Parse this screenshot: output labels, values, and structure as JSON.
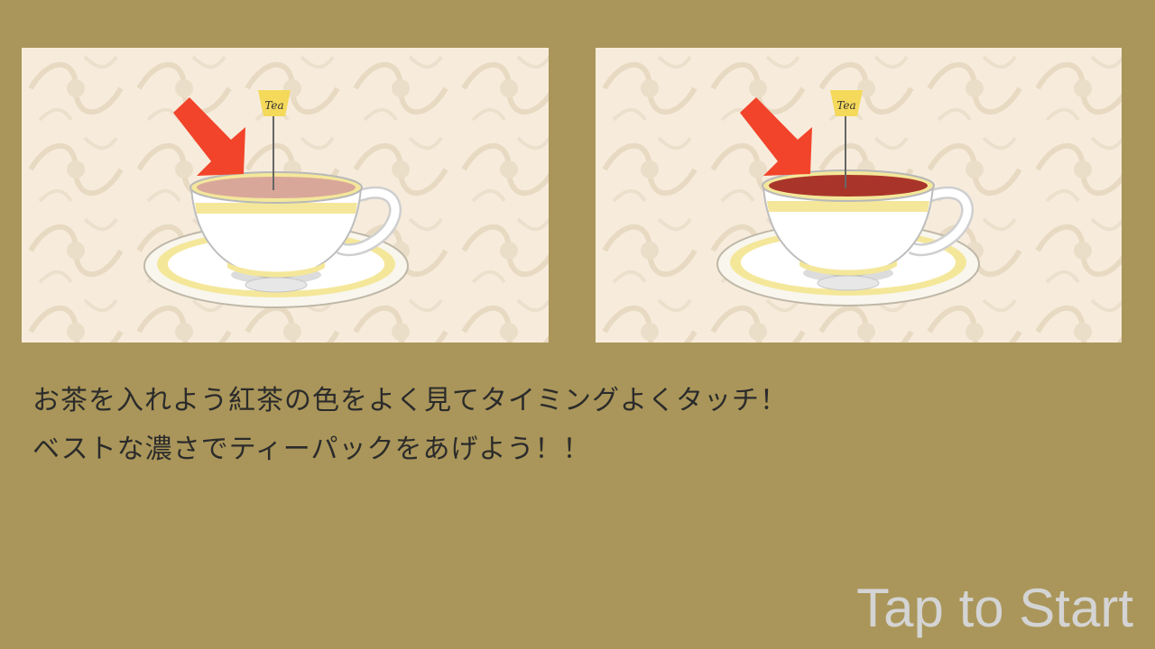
{
  "colors": {
    "background": "#aa965a",
    "panel_bg": "#f7ecdc",
    "ornament": "#e8dac2",
    "gold_band": "#f4e79a",
    "arrow": "#f2442a",
    "tea_light": "#d9a79a",
    "tea_dark": "#a9352a",
    "start_text": "#d4d4d4"
  },
  "panels": [
    {
      "tag_text": "Tea",
      "tea_color": "#d9a79a",
      "state": "light"
    },
    {
      "tag_text": "Tea",
      "tea_color": "#a9352a",
      "state": "dark"
    }
  ],
  "instructions": {
    "line1": "お茶を入れよう紅茶の色をよく見てタイミングよくタッチ！",
    "line2": "ベストな濃さでティーパックをあげよう！！"
  },
  "start_button": {
    "label": "Tap to Start"
  },
  "icons": [
    "arrow-icon",
    "teacup-icon",
    "tea-tag-icon"
  ]
}
